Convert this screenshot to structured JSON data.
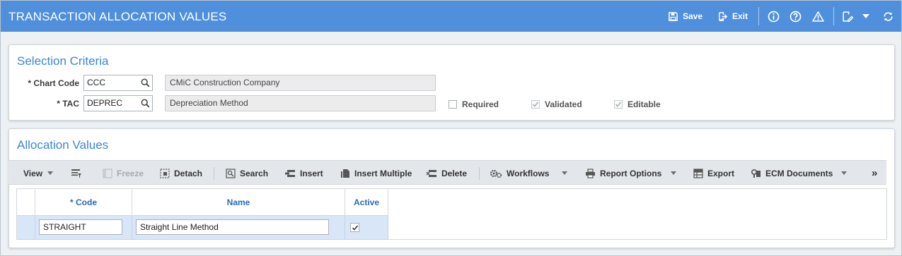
{
  "header": {
    "title": "TRANSACTION ALLOCATION VALUES",
    "save_label": "Save",
    "exit_label": "Exit"
  },
  "selection": {
    "title": "Selection Criteria",
    "chart_code_label": "Chart Code",
    "chart_code_value": "CCC",
    "chart_code_desc": "CMiC Construction Company",
    "tac_label": "TAC",
    "tac_value": "DEPREC",
    "tac_desc": "Depreciation Method",
    "required_label": "Required",
    "required_checked": false,
    "validated_label": "Validated",
    "validated_checked": true,
    "editable_label": "Editable",
    "editable_checked": true,
    "required_marker": "*"
  },
  "allocation": {
    "title": "Allocation Values",
    "toolbar": {
      "view": "View",
      "freeze": "Freeze",
      "detach": "Detach",
      "search": "Search",
      "insert": "Insert",
      "insert_multiple": "Insert Multiple",
      "delete": "Delete",
      "workflows": "Workflows",
      "report_options": "Report Options",
      "export": "Export",
      "ecm_documents": "ECM Documents",
      "more": "»"
    },
    "columns": {
      "code": "* Code",
      "name": "Name",
      "active": "Active"
    },
    "rows": [
      {
        "code": "STRAIGHT",
        "name": "Straight Line Method",
        "active": true
      }
    ]
  }
}
